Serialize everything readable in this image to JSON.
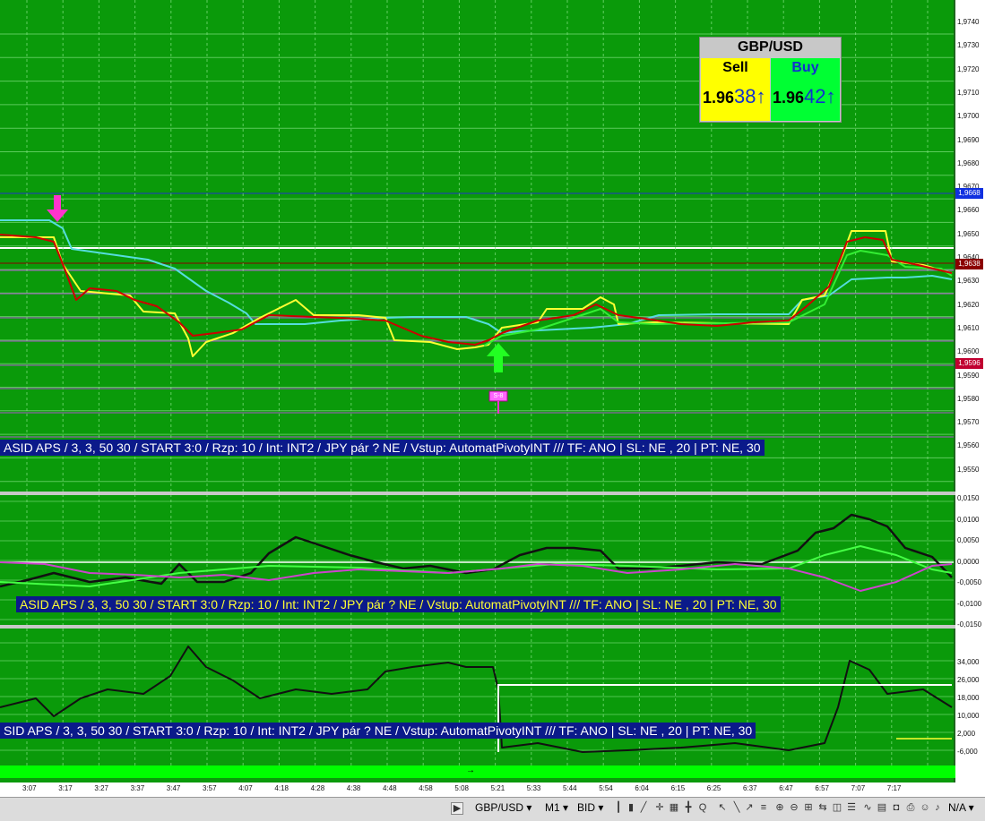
{
  "quote": {
    "symbol": "GBP/USD",
    "sell_label": "Sell",
    "buy_label": "Buy",
    "sell_price_prefix": "1.96",
    "sell_price_pips": "38",
    "buy_price_prefix": "1.96",
    "buy_price_pips": "42",
    "sell_arrow": "↑",
    "buy_arrow": "↑",
    "sell_bg": "#ffff00",
    "buy_bg": "#00ff33"
  },
  "info_bars": {
    "panel1": "ASID APS / 3, 3,  50   30 / START 3:0 / Rzp: 10 / Int: INT2 / JPY pár ? NE / Vstup: AutomatPivotyINT   /// TF: ANO |  SL: NE , 20 | PT: NE, 30",
    "panel2": "ASID APS / 3, 3,  50   30 / START 3:0 / Rzp: 10 / Int: INT2 / JPY pár ? NE / Vstup: AutomatPivotyINT   /// TF: ANO |  SL: NE , 20 | PT: NE, 30",
    "panel3": "SID APS / 3, 3,  50   30 / START 3:0 / Rzp: 10 / Int: INT2 / JPY pár ? NE / Vstup: AutomatPivotyINT   /// TF: ANO |  SL: NE , 20 | PT: NE, 30"
  },
  "price_axis": [
    "1,9740",
    "1,9730",
    "1,9720",
    "1,9710",
    "1,9700",
    "1,9690",
    "1,9680",
    "1,9670",
    "1,9660",
    "1,9650",
    "1,9640",
    "1,9630",
    "1,9620",
    "1,9610",
    "1,9600",
    "1,9590",
    "1,9580",
    "1,9570",
    "1,9560",
    "1,9550"
  ],
  "price_tags": {
    "blue": "1,9668",
    "red": "1,9638",
    "bottom": "1,9596"
  },
  "osc_axis": [
    "0,0150",
    "0,0100",
    "0,0050",
    "0,0000",
    "-0,0050",
    "-0,0100",
    "-0,0150"
  ],
  "vol_axis": [
    "34,000",
    "26,000",
    "18,000",
    "10,000",
    "2,000",
    "-6,000"
  ],
  "signal_label": "S-8",
  "time_axis": [
    "3:07",
    "3:17",
    "3:27",
    "3:37",
    "3:47",
    "3:57",
    "4:07",
    "4:18",
    "4:28",
    "4:38",
    "4:48",
    "4:58",
    "5:08",
    "5:21",
    "5:33",
    "5:44",
    "5:54",
    "6:04",
    "6:15",
    "6:25",
    "6:37",
    "6:47",
    "6:57",
    "7:07",
    "7:17"
  ],
  "toolbar": {
    "symbol": "GBP/USD",
    "timeframe": "M1",
    "price_type": "BID",
    "na": "N/A",
    "scroll_arrow": "▶"
  },
  "colors": {
    "background": "#0a9a0a",
    "grid": "#7fe07f",
    "info_bar": "#0b1a8a",
    "price_line": "#cc0000",
    "upper_band": "#ffff33",
    "lower_band": "#33ee33",
    "trail_line": "#55dddd",
    "sell_arrow": "#ff33cc",
    "buy_arrow": "#22ff22"
  }
}
